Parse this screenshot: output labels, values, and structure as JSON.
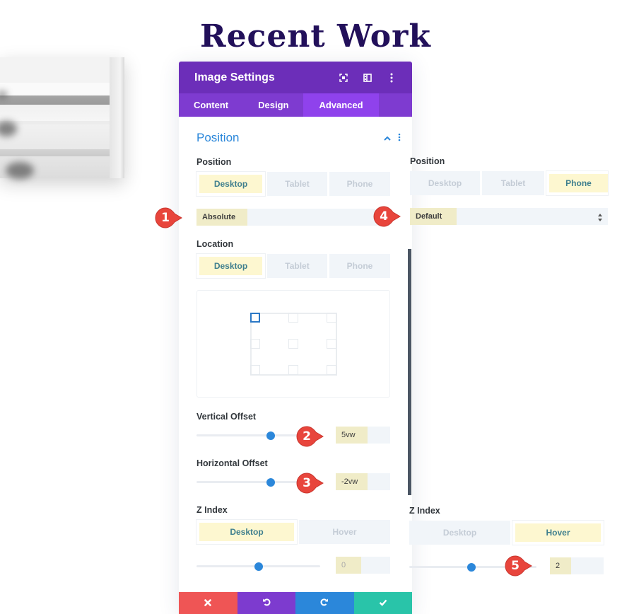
{
  "page": {
    "title": "Recent Work"
  },
  "panel": {
    "title": "Image Settings",
    "header_icons": [
      "fullscreen-icon",
      "sidebar-layout-icon",
      "more-vertical-icon"
    ],
    "tabs": [
      {
        "label": "Content",
        "active": false
      },
      {
        "label": "Design",
        "active": false
      },
      {
        "label": "Advanced",
        "active": true
      }
    ],
    "section": {
      "title": "Position",
      "expanded": true
    },
    "position": {
      "label": "Position",
      "devices": [
        "Desktop",
        "Tablet",
        "Phone"
      ],
      "active_device": "Desktop",
      "value": "Absolute"
    },
    "location": {
      "label": "Location",
      "devices": [
        "Desktop",
        "Tablet",
        "Phone"
      ],
      "active_device": "Desktop",
      "selected_cell": "top-left"
    },
    "vertical_offset": {
      "label": "Vertical Offset",
      "value": "5vw",
      "slider_fraction": 0.6
    },
    "horizontal_offset": {
      "label": "Horizontal Offset",
      "value": "-2vw",
      "slider_fraction": 0.6
    },
    "z_index": {
      "label": "Z Index",
      "modes": [
        "Desktop",
        "Hover"
      ],
      "active_mode": "Desktop",
      "value": "0",
      "slider_fraction": 0.5
    }
  },
  "overlay_position": {
    "label": "Position",
    "devices": [
      "Desktop",
      "Tablet",
      "Phone"
    ],
    "active_device": "Phone",
    "value": "Default"
  },
  "overlay_z_index": {
    "label": "Z Index",
    "modes": [
      "Desktop",
      "Hover"
    ],
    "active_mode": "Hover",
    "value": "2",
    "slider_fraction": 0.5
  },
  "footer": {
    "buttons": [
      {
        "name": "discard",
        "icon": "close-icon",
        "color": "#ef5555"
      },
      {
        "name": "undo",
        "icon": "undo-icon",
        "color": "#7d3bcf"
      },
      {
        "name": "redo",
        "icon": "redo-icon",
        "color": "#2b87da"
      },
      {
        "name": "save",
        "icon": "check-icon",
        "color": "#29c4a9"
      }
    ]
  },
  "markers": [
    "1",
    "2",
    "3",
    "4",
    "5"
  ],
  "colors": {
    "header_purple": "#6c2eb9",
    "tab_purple": "#7e3bd0",
    "tab_active": "#8f42ec",
    "accent_blue": "#2b87da",
    "marker_red": "#e8453c",
    "title_navy": "#22105a"
  }
}
